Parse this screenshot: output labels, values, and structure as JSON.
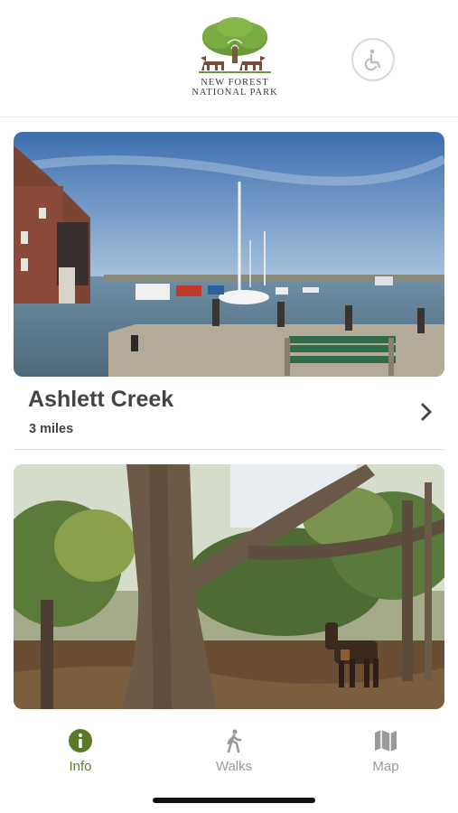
{
  "header": {
    "logo_line1": "NEW FOREST",
    "logo_line2": "NATIONAL PARK",
    "accessibility_icon": "wheelchair-icon"
  },
  "walks": [
    {
      "title": "Ashlett Creek",
      "distance": "3 miles",
      "image": "harbour-scene"
    },
    {
      "title": "",
      "distance": "",
      "image": "forest-pony-scene"
    }
  ],
  "tabs": [
    {
      "label": "Info",
      "icon": "info-icon",
      "active": true
    },
    {
      "label": "Walks",
      "icon": "walker-icon",
      "active": false
    },
    {
      "label": "Map",
      "icon": "map-icon",
      "active": false
    }
  ],
  "colors": {
    "brand_green": "#5a7a2a",
    "inactive_tab": "#9a9a9a",
    "text": "#444444"
  }
}
